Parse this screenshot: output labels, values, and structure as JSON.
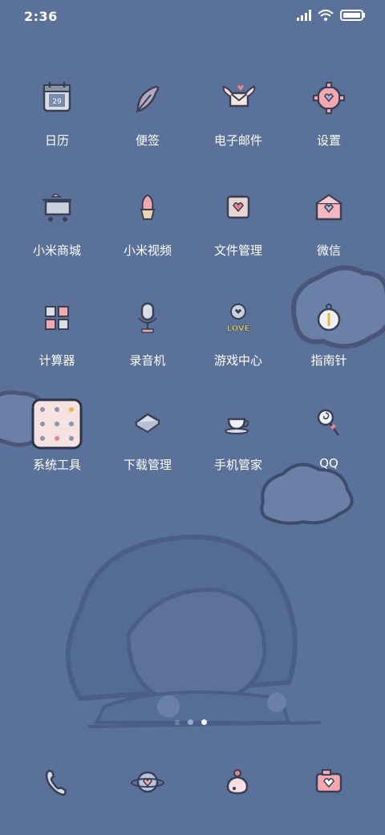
{
  "status": {
    "time": "2:36"
  },
  "apps": [
    {
      "label": "日历",
      "icon": "calendar-icon",
      "badge": "29"
    },
    {
      "label": "便签",
      "icon": "feather-icon"
    },
    {
      "label": "电子邮件",
      "icon": "envelope-wings-icon"
    },
    {
      "label": "设置",
      "icon": "gear-heart-icon"
    },
    {
      "label": "小米商城",
      "icon": "shopping-cart-icon"
    },
    {
      "label": "小米视频",
      "icon": "cupcake-icon"
    },
    {
      "label": "文件管理",
      "icon": "heart-card-icon"
    },
    {
      "label": "微信",
      "icon": "love-letter-icon"
    },
    {
      "label": "计算器",
      "icon": "calculator-icon"
    },
    {
      "label": "录音机",
      "icon": "microphone-icon"
    },
    {
      "label": "游戏中心",
      "icon": "love-bubble-icon",
      "text": "LOVE"
    },
    {
      "label": "指南针",
      "icon": "pocket-watch-icon"
    },
    {
      "label": "系统工具",
      "icon": "folder-icon"
    },
    {
      "label": "下载管理",
      "icon": "waffle-icon"
    },
    {
      "label": "手机管家",
      "icon": "teacup-icon"
    },
    {
      "label": "QQ",
      "icon": "lollipop-icon"
    }
  ],
  "pages": {
    "count": 2,
    "active": 2
  },
  "dock": [
    {
      "icon": "phone-icon"
    },
    {
      "icon": "planet-heart-icon"
    },
    {
      "icon": "cake-icon"
    },
    {
      "icon": "camera-heart-icon"
    }
  ],
  "colors": {
    "background": "#5a7199",
    "accent_pink": "#f3a7ae",
    "outline": "#3a3f55"
  }
}
